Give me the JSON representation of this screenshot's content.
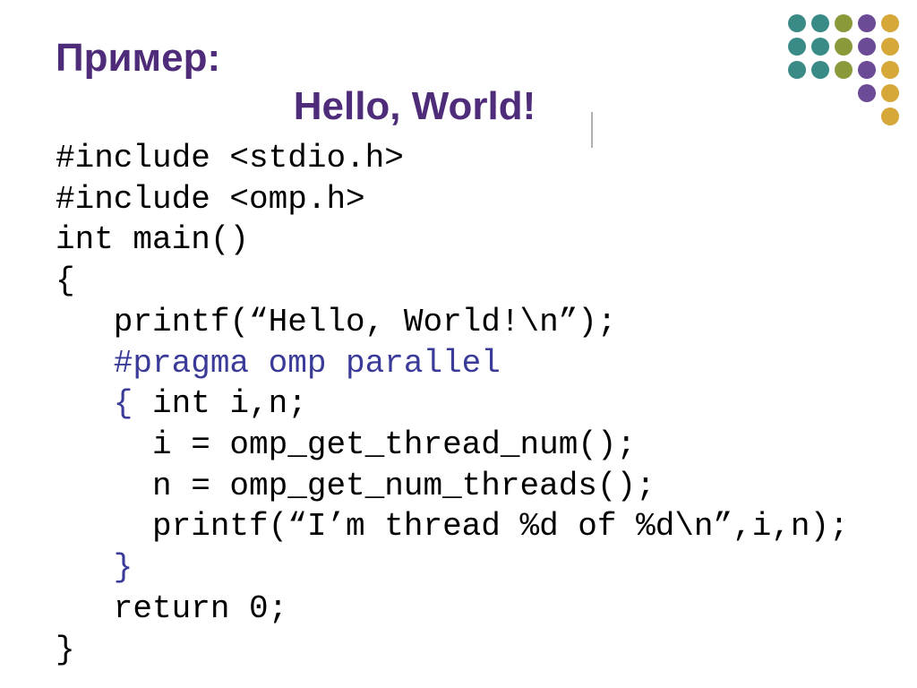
{
  "heading": {
    "primer": "Пример:",
    "hello": "Hello, World!"
  },
  "code": {
    "l1": "#include <stdio.h>",
    "l2": "#include <omp.h>",
    "l3": "int main()",
    "l4": "{",
    "l5": "   printf(“Hello, World!\\n”);",
    "l6": "   #pragma omp parallel",
    "l7": "   {",
    "l7b": " int i,n;",
    "l8": "     i = omp_get_thread_num();",
    "l9": "     n = omp_get_num_threads();",
    "l10": "     printf(“I’m thread %d of %d\\n”,i,n);",
    "l11": "   }",
    "l12": "   return 0;",
    "l13": "}"
  },
  "decor": {
    "dot_colors": {
      "teal": "#3a8a86",
      "olive": "#8a9a3a",
      "purple": "#6b4a96",
      "gold": "#d6a83a"
    },
    "dot_grid": [
      "teal",
      "teal",
      "olive",
      "purple",
      "gold",
      "teal",
      "teal",
      "olive",
      "purple",
      "gold",
      "teal",
      "teal",
      "olive",
      "purple",
      "gold",
      "",
      "",
      "",
      "purple",
      "gold",
      "",
      "",
      "",
      "",
      "gold"
    ]
  }
}
